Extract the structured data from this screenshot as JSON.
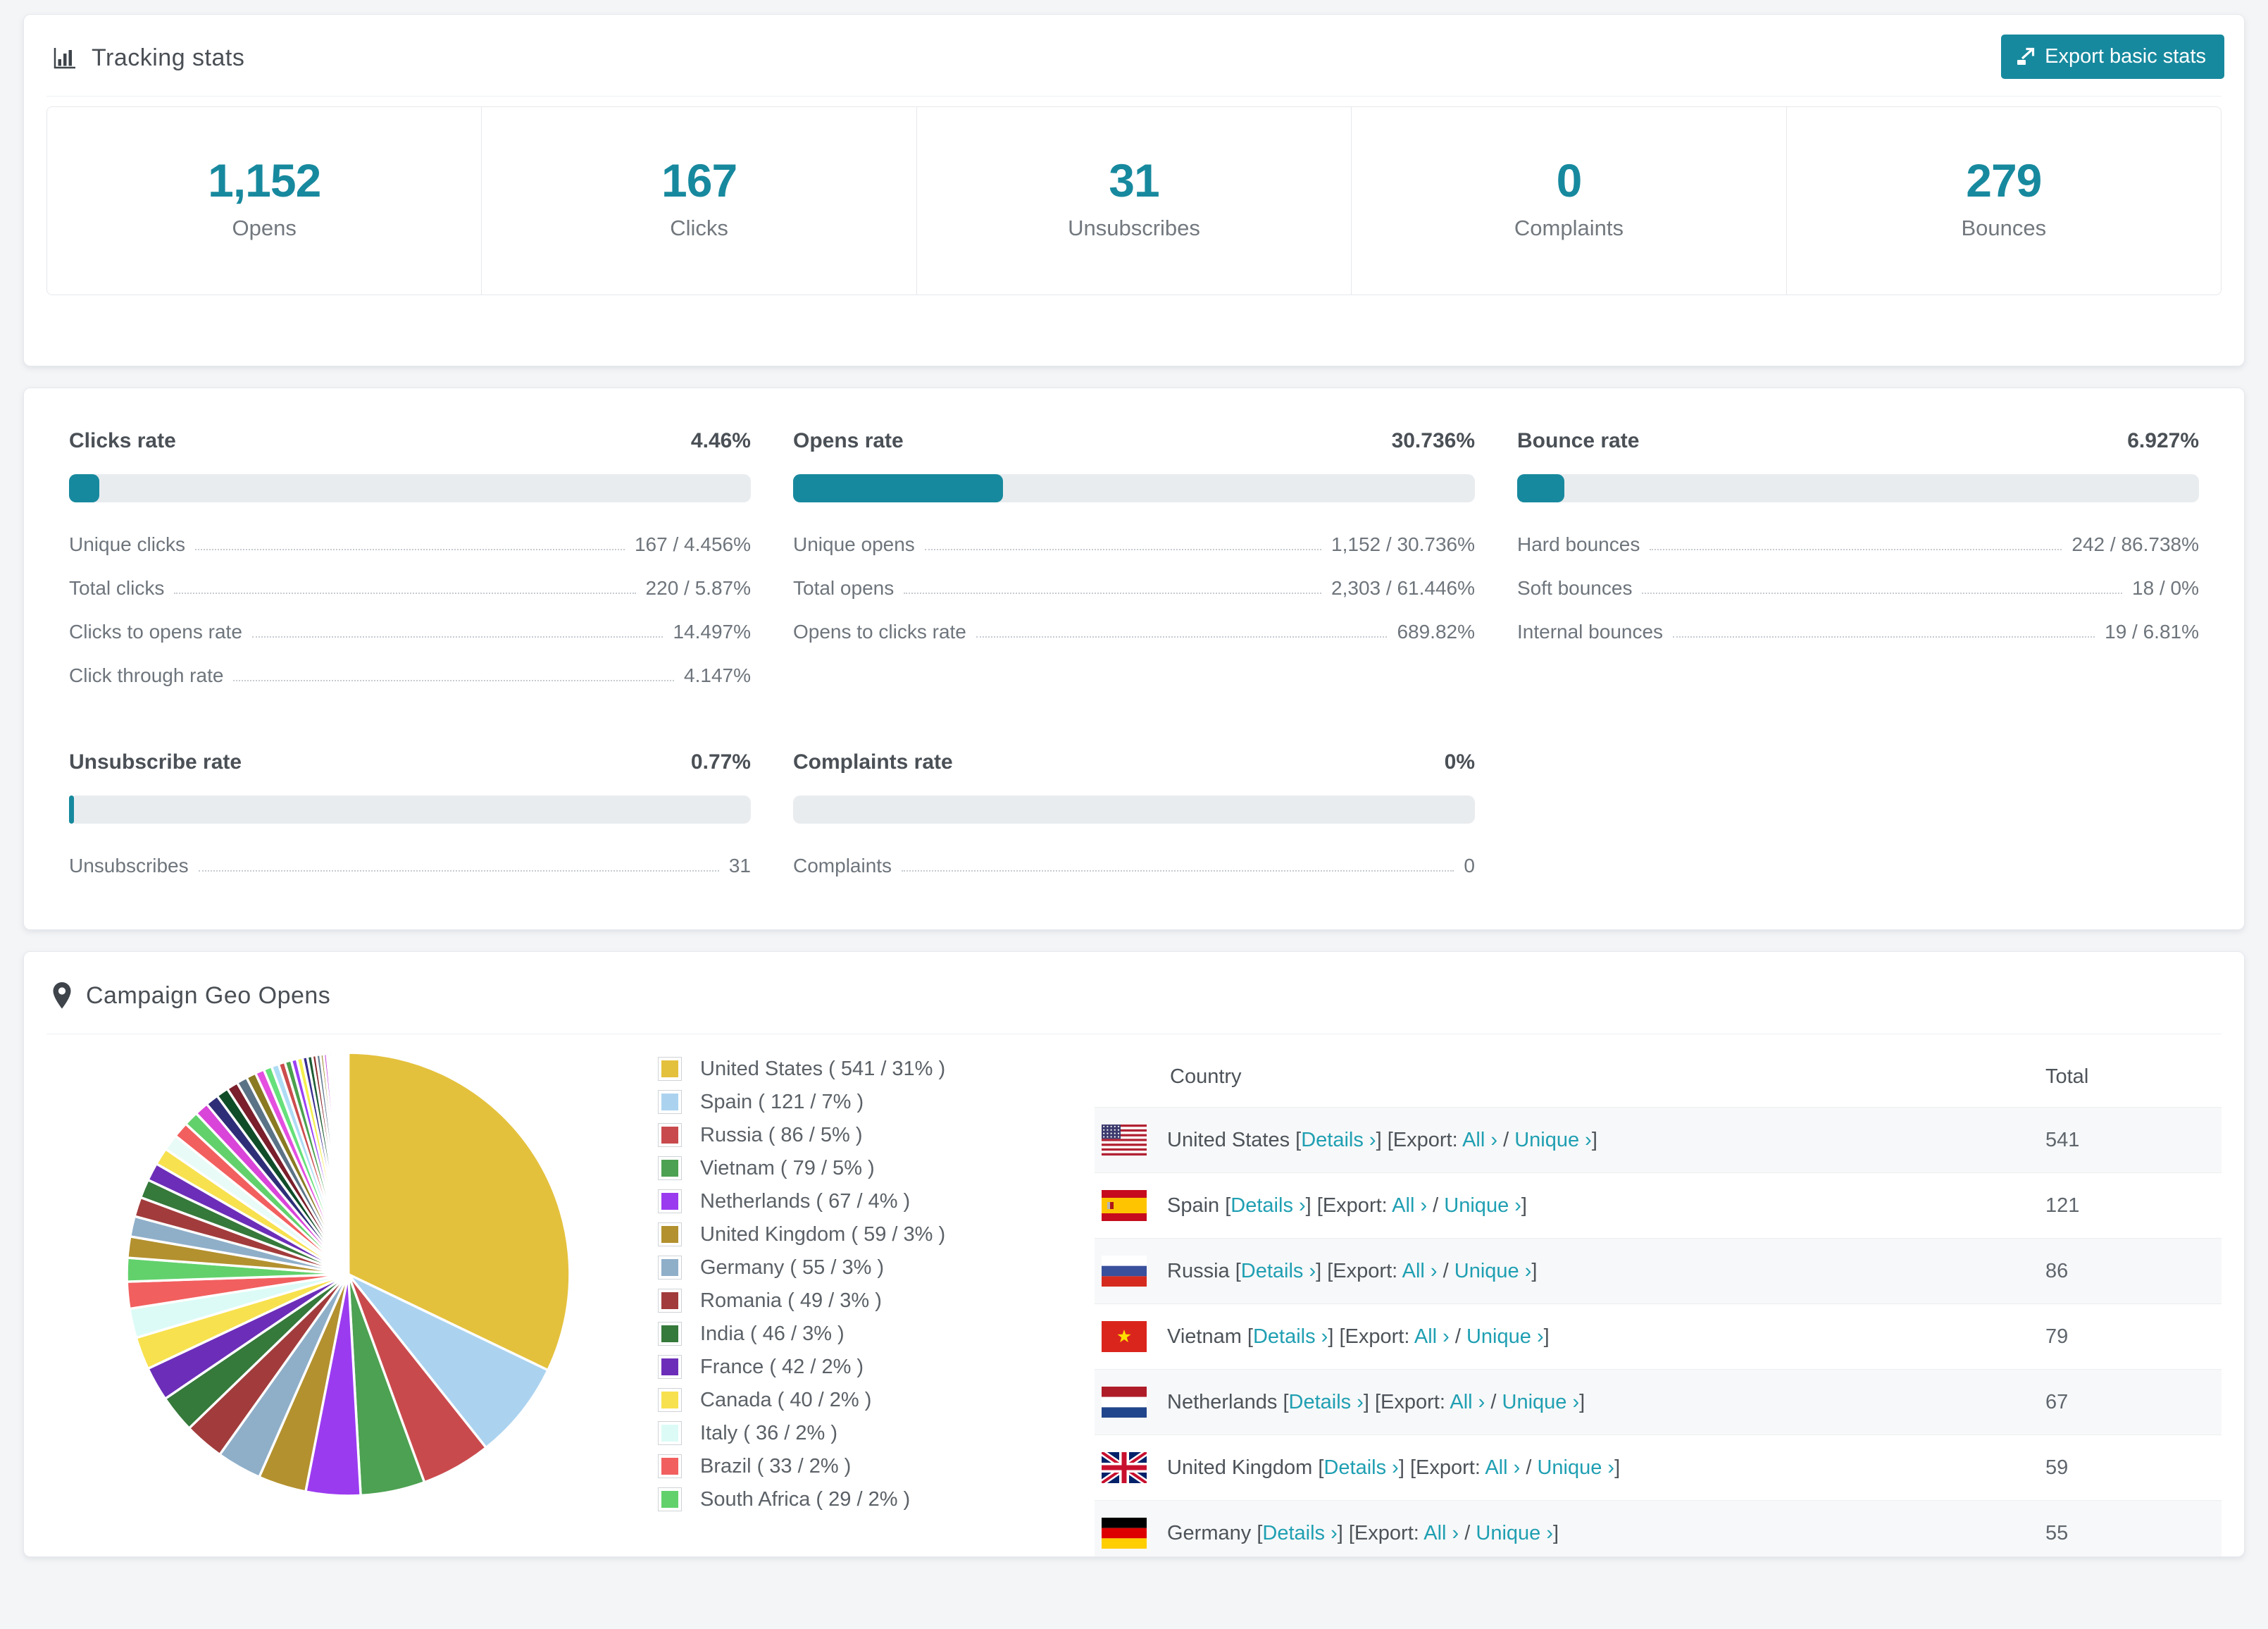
{
  "colors": {
    "accent": "#17899e",
    "link": "#1f9fb2",
    "bar_track": "#e9ecef"
  },
  "tracking": {
    "title": "Tracking stats",
    "export_label": "Export basic stats",
    "summary": [
      {
        "value": "1,152",
        "label": "Opens"
      },
      {
        "value": "167",
        "label": "Clicks"
      },
      {
        "value": "31",
        "label": "Unsubscribes"
      },
      {
        "value": "0",
        "label": "Complaints"
      },
      {
        "value": "279",
        "label": "Bounces"
      }
    ]
  },
  "rates": {
    "panels": [
      {
        "title": "Clicks rate",
        "value": "4.46%",
        "percent": 4.46,
        "rows": [
          [
            "Unique clicks",
            "167 / 4.456%"
          ],
          [
            "Total clicks",
            "220 / 5.87%"
          ],
          [
            "Clicks to opens rate",
            "14.497%"
          ],
          [
            "Click through rate",
            "4.147%"
          ]
        ]
      },
      {
        "title": "Opens rate",
        "value": "30.736%",
        "percent": 30.736,
        "rows": [
          [
            "Unique opens",
            "1,152 / 30.736%"
          ],
          [
            "Total opens",
            "2,303 / 61.446%"
          ],
          [
            "Opens to clicks rate",
            "689.82%"
          ]
        ]
      },
      {
        "title": "Bounce rate",
        "value": "6.927%",
        "percent": 6.927,
        "rows": [
          [
            "Hard bounces",
            "242 / 86.738%"
          ],
          [
            "Soft bounces",
            "18 / 0%"
          ],
          [
            "Internal bounces",
            "19 / 6.81%"
          ]
        ]
      },
      {
        "title": "Unsubscribe rate",
        "value": "0.77%",
        "percent": 0.77,
        "rows": [
          [
            "Unsubscribes",
            "31"
          ]
        ]
      },
      {
        "title": "Complaints rate",
        "value": "0%",
        "percent": 0,
        "rows": [
          [
            "Complaints",
            "0"
          ]
        ]
      }
    ]
  },
  "geo": {
    "title": "Campaign Geo Opens",
    "table": {
      "columns": [
        "Country",
        "Total"
      ],
      "link_labels": {
        "details": "Details ›",
        "export_prefix": "[Export:",
        "all": "All ›",
        "slash": "/",
        "unique": "Unique ›",
        "open_bracket": "[",
        "close_bracket": "]"
      },
      "rows": [
        {
          "flag": "us",
          "country": "United States",
          "total": "541"
        },
        {
          "flag": "es",
          "country": "Spain",
          "total": "121"
        },
        {
          "flag": "ru",
          "country": "Russia",
          "total": "86"
        },
        {
          "flag": "vn",
          "country": "Vietnam",
          "total": "79"
        },
        {
          "flag": "nl",
          "country": "Netherlands",
          "total": "67"
        },
        {
          "flag": "gb",
          "country": "United Kingdom",
          "total": "59"
        },
        {
          "flag": "de",
          "country": "Germany",
          "total": "55"
        }
      ]
    },
    "chart_data": {
      "type": "pie",
      "title": "Campaign Geo Opens",
      "legend_position": "right-of-pie",
      "slices": [
        {
          "label": "United States ( 541 / 31% )",
          "name": "United States",
          "value": 541,
          "pct": "31%",
          "color": "#e4c13d"
        },
        {
          "label": "Spain ( 121 / 7% )",
          "name": "Spain",
          "value": 121,
          "pct": "7%",
          "color": "#abd3f0"
        },
        {
          "label": "Russia ( 86 / 5% )",
          "name": "Russia",
          "value": 86,
          "pct": "5%",
          "color": "#c94a4d"
        },
        {
          "label": "Vietnam ( 79 / 5% )",
          "name": "Vietnam",
          "value": 79,
          "pct": "5%",
          "color": "#4da152"
        },
        {
          "label": "Netherlands ( 67 / 4% )",
          "name": "Netherlands",
          "value": 67,
          "pct": "4%",
          "color": "#9b3bf0"
        },
        {
          "label": "United Kingdom ( 59 / 3% )",
          "name": "United Kingdom",
          "value": 59,
          "pct": "3%",
          "color": "#b3912f"
        },
        {
          "label": "Germany ( 55 / 3% )",
          "name": "Germany",
          "value": 55,
          "pct": "3%",
          "color": "#8fafc9"
        },
        {
          "label": "Romania ( 49 / 3% )",
          "name": "Romania",
          "value": 49,
          "pct": "3%",
          "color": "#a23c3c"
        },
        {
          "label": "India ( 46 / 3% )",
          "name": "India",
          "value": 46,
          "pct": "3%",
          "color": "#35793b"
        },
        {
          "label": "France ( 42 / 2% )",
          "name": "France",
          "value": 42,
          "pct": "2%",
          "color": "#6c2eb8"
        },
        {
          "label": "Canada ( 40 / 2% )",
          "name": "Canada",
          "value": 40,
          "pct": "2%",
          "color": "#f7e14e"
        },
        {
          "label": "Italy ( 36 / 2% )",
          "name": "Italy",
          "value": 36,
          "pct": "2%",
          "color": "#dcfbf6"
        },
        {
          "label": "Brazil ( 33 / 2% )",
          "name": "Brazil",
          "value": 33,
          "pct": "2%",
          "color": "#f25f5f"
        },
        {
          "label": "South Africa ( 29 / 2% )",
          "name": "South Africa",
          "value": 29,
          "pct": "2%",
          "color": "#62d16c"
        }
      ],
      "other_slices_values": [
        26,
        25,
        24,
        23,
        22,
        21,
        20,
        19,
        18,
        17,
        16,
        15,
        14,
        13,
        12,
        11,
        10,
        9,
        8,
        8,
        7,
        7,
        6,
        6,
        5,
        5,
        4,
        4,
        3,
        3,
        3,
        2,
        2,
        2,
        2,
        1,
        1,
        1,
        1,
        1,
        1,
        1,
        1,
        1
      ],
      "other_slices_palette": [
        "#b3912f",
        "#8fafc9",
        "#a23c3c",
        "#35793b",
        "#6c2eb8",
        "#f7e14e",
        "#e9fbf7",
        "#f25f5f",
        "#62d16c",
        "#d945d9",
        "#2e2e78",
        "#0f4d28",
        "#7a1f2b",
        "#5b7386",
        "#8a7a22",
        "#e44fe0",
        "#66e07a",
        "#aedcf5",
        "#cc4c4e",
        "#4aa14e",
        "#9b40f5",
        "#f5ef4e",
        "#3a2f8f",
        "#1d5c33",
        "#8c2f2f",
        "#667f93",
        "#9c8b2d",
        "#c94fe0",
        "#7be08a",
        "#fc6b6b",
        "#f0fdf9",
        "#e8c33d",
        "#a8d2f0",
        "#d1455b",
        "#4cc257"
      ]
    }
  }
}
